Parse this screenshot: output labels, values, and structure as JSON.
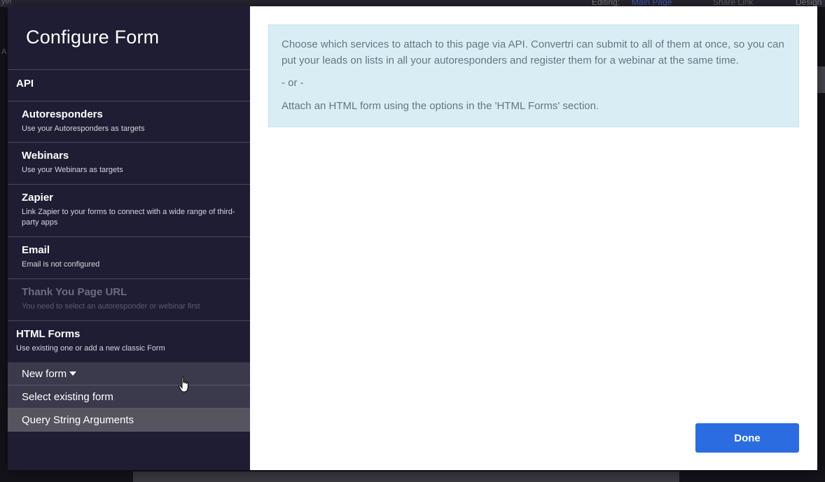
{
  "background": {
    "left_text": "yel",
    "left_label": "A",
    "editing_label": "Editing:",
    "editing_value": "Main Page",
    "share_label": "Share Link",
    "design_label": "Design"
  },
  "modal": {
    "title": "Configure Form",
    "sidebar": {
      "api_header": "API",
      "items": [
        {
          "label": "Autoresponders",
          "desc": "Use your Autoresponders as targets",
          "disabled": false
        },
        {
          "label": "Webinars",
          "desc": "Use your Webinars as targets",
          "disabled": false
        },
        {
          "label": "Zapier",
          "desc": "Link Zapier to your forms to connect with a wide range of third-party apps",
          "disabled": false
        },
        {
          "label": "Email",
          "desc": "Email is not configured",
          "disabled": false
        },
        {
          "label": "Thank You Page URL",
          "desc": "You need to select an autoresponder or webinar first",
          "disabled": true
        }
      ],
      "html_forms": {
        "label": "HTML Forms",
        "desc": "Use existing one or add a new classic Form",
        "options": [
          {
            "label": "New form"
          },
          {
            "label": "Select existing form"
          },
          {
            "label": "Query String Arguments"
          }
        ]
      }
    },
    "info": {
      "paragraph1": "Choose which services to attach to this page via API. Convertri can submit to all of them at once, so you can put your leads on lists in all your autoresponders and register them for a webinar at the same time.",
      "or": "- or -",
      "paragraph2": "Attach an HTML form using the options in the 'HTML Forms' section."
    },
    "done_label": "Done"
  },
  "colors": {
    "sidebar_bg": "#1f1d33",
    "info_bg": "#d9eef4",
    "done_button": "#2b6de0"
  }
}
